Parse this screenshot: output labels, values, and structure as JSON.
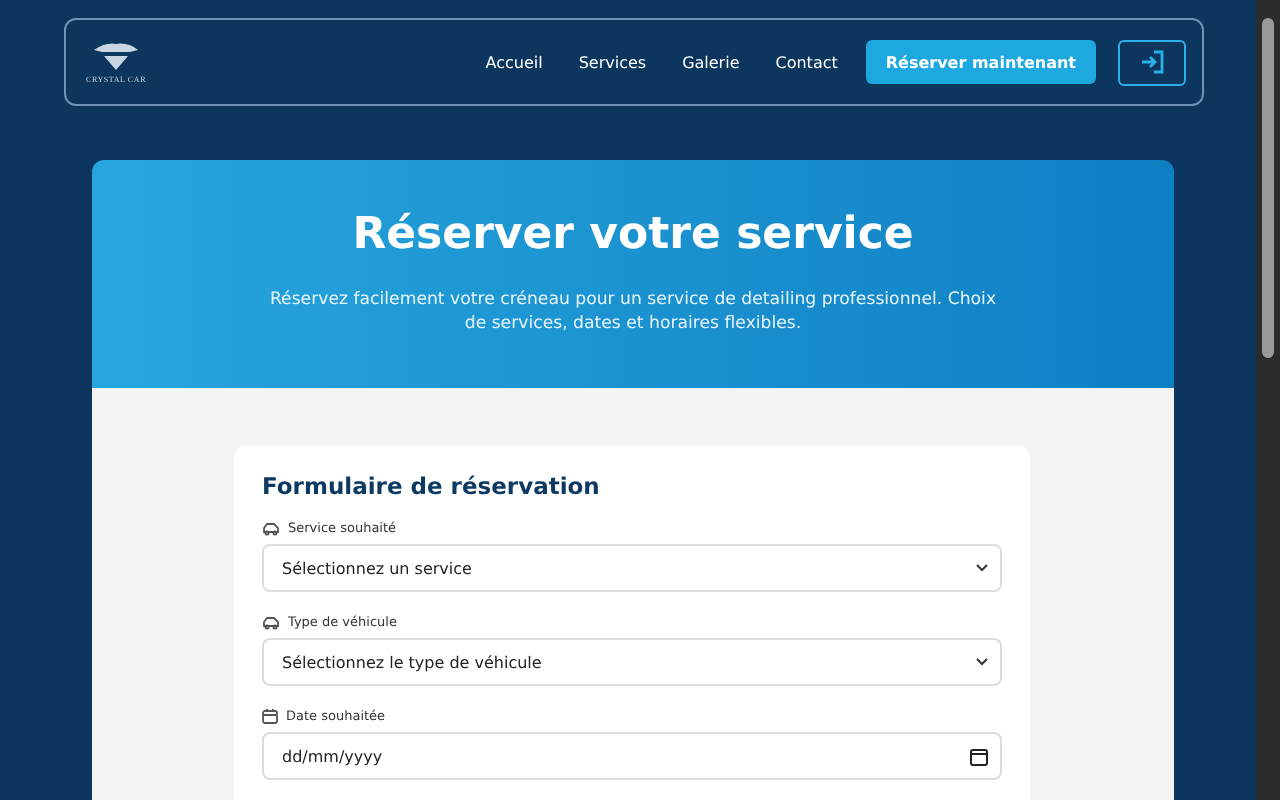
{
  "header": {
    "logo_text": "CRYSTAL CAR",
    "nav": [
      {
        "label": "Accueil"
      },
      {
        "label": "Services"
      },
      {
        "label": "Galerie"
      },
      {
        "label": "Contact"
      }
    ],
    "cta": "Réserver maintenant"
  },
  "hero": {
    "title": "Réserver votre service",
    "subtitle": "Réservez facilement votre créneau pour un service de detailing professionnel. Choix de services, dates et horaires flexibles."
  },
  "form": {
    "title": "Formulaire de réservation",
    "fields": [
      {
        "kind": "select",
        "label": "Service souhaité",
        "value": "Sélectionnez un service"
      },
      {
        "kind": "select",
        "label": "Type de véhicule",
        "value": "Sélectionnez le type de véhicule"
      },
      {
        "kind": "date",
        "label": "Date souhaitée",
        "value": "dd/mm/yyyy"
      }
    ]
  }
}
